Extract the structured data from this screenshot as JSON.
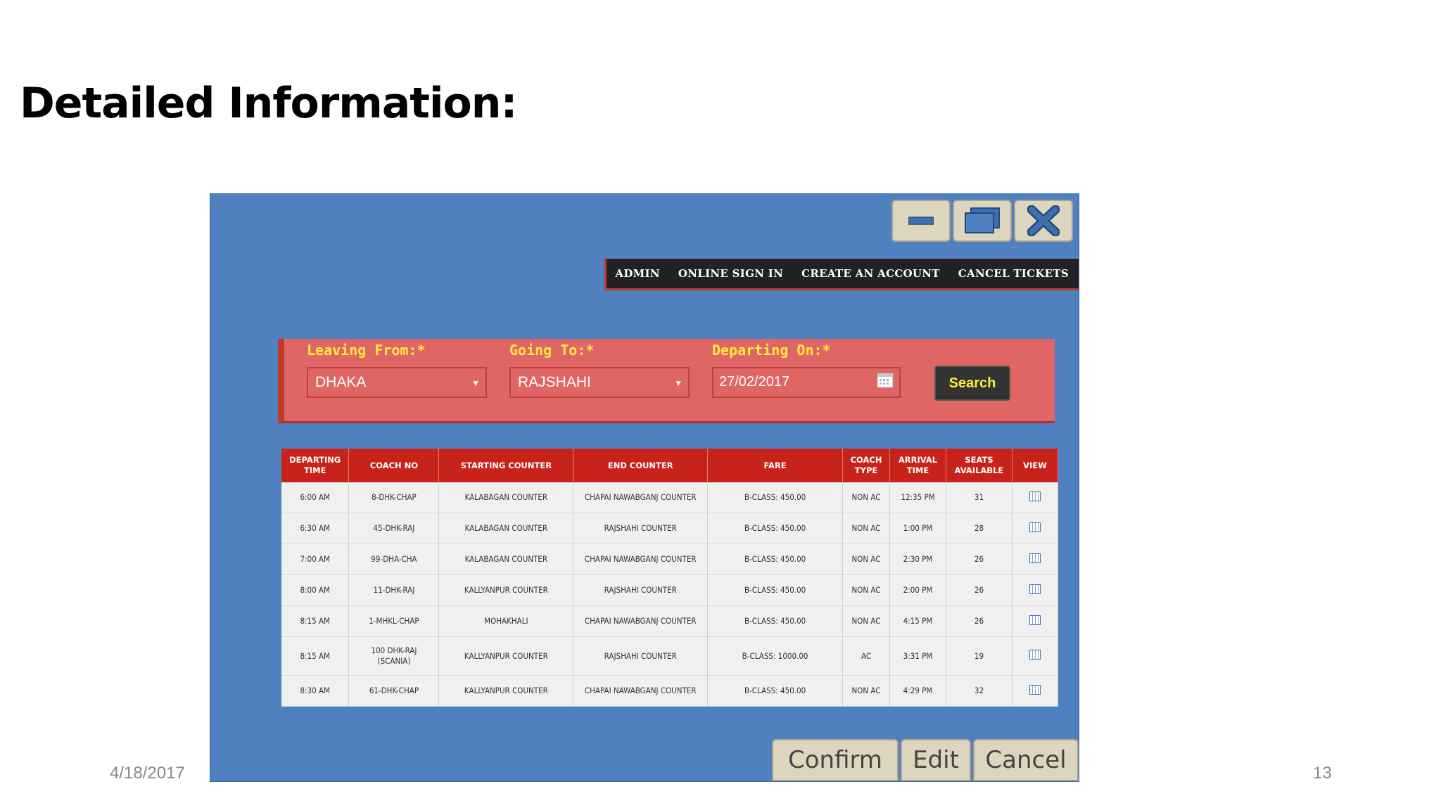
{
  "slide": {
    "title": "Detailed Information:",
    "date": "4/18/2017",
    "page": "13"
  },
  "window": {
    "minimize_icon": "minimize-icon",
    "maximize_icon": "maximize-icon",
    "close_icon": "close-icon"
  },
  "nav": {
    "items": [
      "ADMIN",
      "ONLINE SIGN IN",
      "CREATE AN ACCOUNT",
      "CANCEL TICKETS"
    ]
  },
  "search": {
    "leaving_label": "Leaving From:*",
    "leaving_value": "DHAKA",
    "going_label": "Going To:*",
    "going_value": "RAJSHAHI",
    "departing_label": "Departing On:*",
    "departing_value": "27/02/2017",
    "search_button": "Search",
    "dropdown_arrow": "▼"
  },
  "table": {
    "headers": [
      "DEPARTING TIME",
      "COACH NO",
      "STARTING COUNTER",
      "END COUNTER",
      "FARE",
      "COACH TYPE",
      "ARRIVAL TIME",
      "SEATS AVAILABLE",
      "VIEW"
    ],
    "rows": [
      [
        "6:00 AM",
        "8-DHK-CHAP",
        "KALABAGAN COUNTER",
        "CHAPAI NAWABGANJ COUNTER",
        "B-CLASS: 450.00",
        "NON AC",
        "12:35 PM",
        "31"
      ],
      [
        "6:30 AM",
        "45-DHK-RAJ",
        "KALABAGAN COUNTER",
        "RAJSHAHI COUNTER",
        "B-CLASS: 450.00",
        "NON AC",
        "1:00 PM",
        "28"
      ],
      [
        "7:00 AM",
        "99-DHA-CHA",
        "KALABAGAN COUNTER",
        "CHAPAI NAWABGANJ COUNTER",
        "B-CLASS: 450.00",
        "NON AC",
        "2:30 PM",
        "26"
      ],
      [
        "8:00 AM",
        "11-DHK-RAJ",
        "KALLYANPUR COUNTER",
        "RAJSHAHI COUNTER",
        "B-CLASS: 450.00",
        "NON AC",
        "2:00 PM",
        "26"
      ],
      [
        "8:15 AM",
        "1-MHKL-CHAP",
        "MOHAKHALI",
        "CHAPAI NAWABGANJ COUNTER",
        "B-CLASS: 450.00",
        "NON AC",
        "4:15 PM",
        "26"
      ],
      [
        "8:15 AM",
        "100 DHK-RAJ (SCANIA)",
        "KALLYANPUR COUNTER",
        "RAJSHAHI COUNTER",
        "B-CLASS: 1000.00",
        "AC",
        "3:31 PM",
        "19"
      ],
      [
        "8:30 AM",
        "61-DHK-CHAP",
        "KALLYANPUR COUNTER",
        "CHAPAI NAWABGANJ COUNTER",
        "B-CLASS: 450.00",
        "NON AC",
        "4:29 PM",
        "32"
      ]
    ]
  },
  "actions": {
    "confirm": "Confirm",
    "edit": "Edit",
    "cancel": "Cancel"
  },
  "colors": {
    "window_bg": "#4f81c1",
    "header_red": "#c8231a",
    "panel_red": "#e06666",
    "label_yellow": "#ffeb3b"
  }
}
